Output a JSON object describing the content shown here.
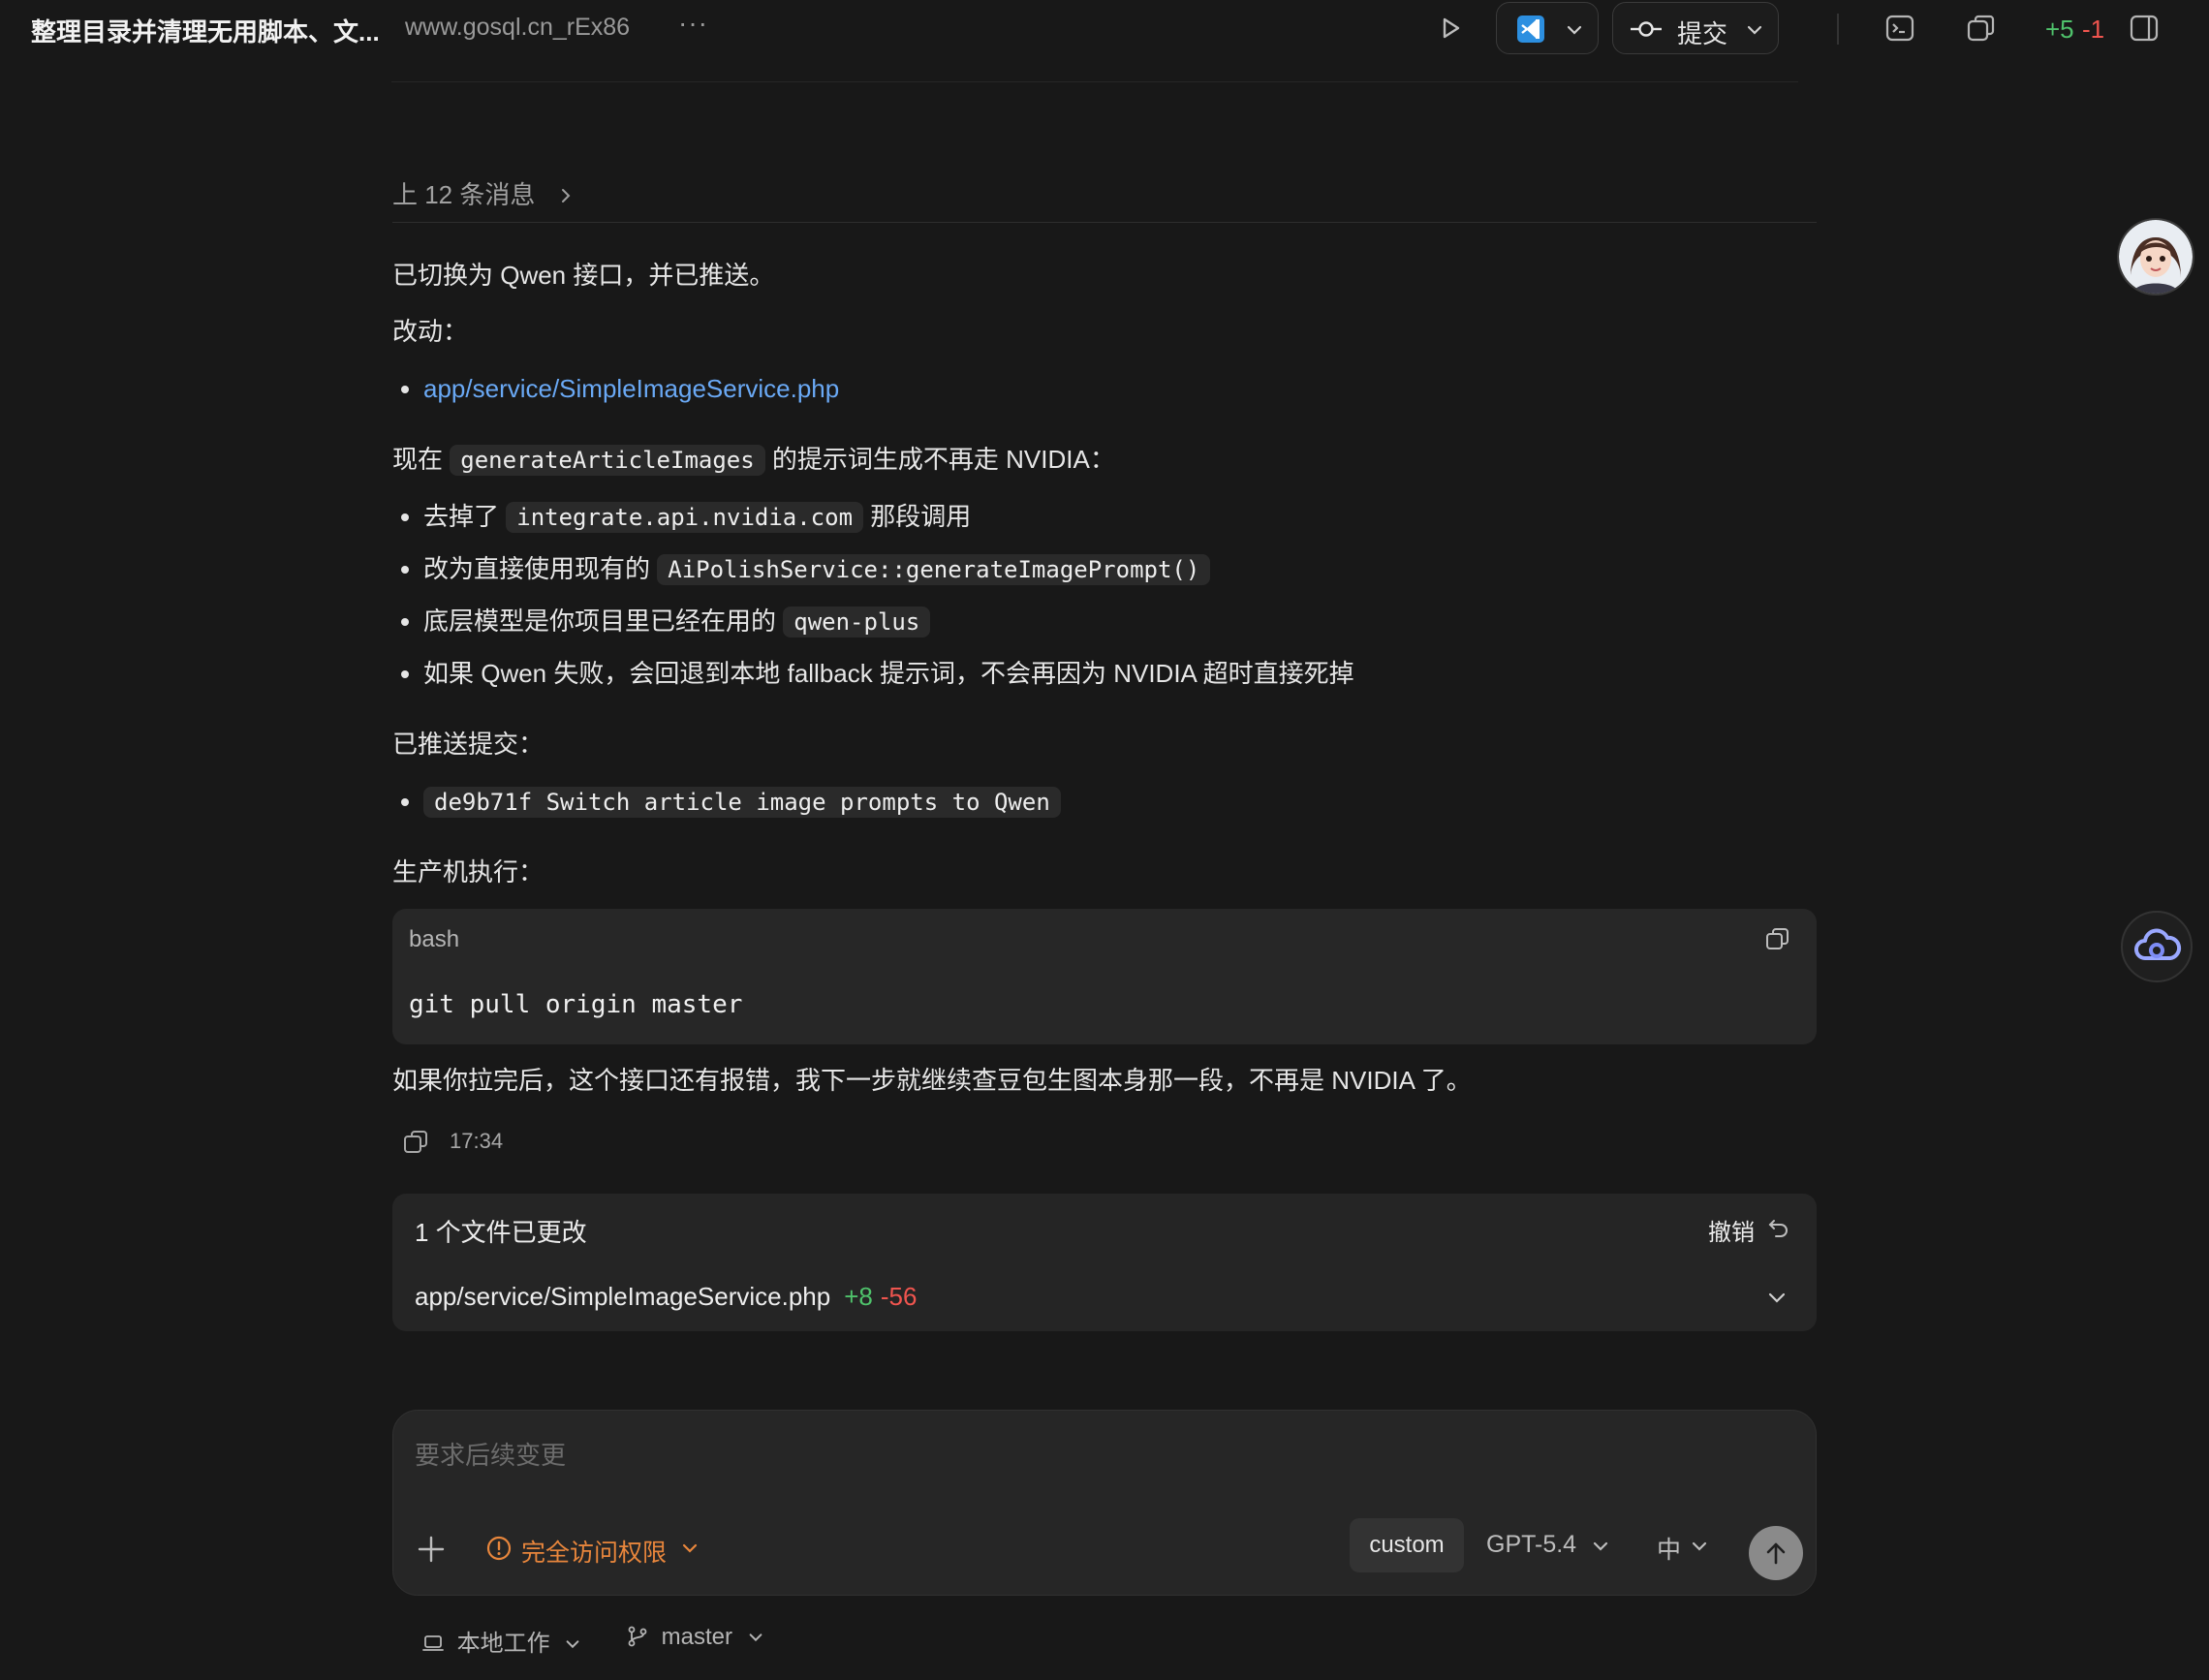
{
  "header": {
    "title": "整理目录并清理无用脚本、文...",
    "subtitle": "www.gosql.cn_rEx86",
    "more_icon": "ellipsis-icon",
    "editor_icon": "vscode-icon",
    "commit_label": "提交",
    "diff_added": "+5",
    "diff_removed": "-1"
  },
  "conversation": {
    "previous_messages": "上 12 条消息",
    "para1": "已切换为 Qwen 接口，并已推送。",
    "changes_heading": "改动：",
    "changed_file_link": "app/service/SimpleImageService.php",
    "para2": {
      "pre": "现在",
      "code": "generateArticleImages",
      "post": "的提示词生成不再走 NVIDIA："
    },
    "bullets": [
      {
        "pre": "去掉了",
        "code": "integrate.api.nvidia.com",
        "post": "那段调用"
      },
      {
        "pre": "改为直接使用现有的",
        "code": "AiPolishService::generateImagePrompt()",
        "post": ""
      },
      {
        "pre": "底层模型是你项目里已经在用的",
        "code": "qwen-plus",
        "post": ""
      },
      {
        "text": "如果 Qwen 失败，会回退到本地 fallback 提示词，不会再因为 NVIDIA 超时直接死掉"
      }
    ],
    "pushed_heading": "已推送提交：",
    "commit_code": "de9b71f Switch article image prompts to Qwen",
    "exec_heading": "生产机执行：",
    "code_block": {
      "lang": "bash",
      "command": "git pull origin master"
    },
    "closing": "如果你拉完后，这个接口还有报错，我下一步就继续查豆包生图本身那一段，不再是 NVIDIA 了。",
    "timestamp": "17:34"
  },
  "changes_card": {
    "header": "1 个文件已更改",
    "undo_label": "撤销",
    "file": "app/service/SimpleImageService.php",
    "added": "+8",
    "removed": "-56"
  },
  "composer": {
    "placeholder": "要求后续变更",
    "permission_label": "完全访问权限",
    "custom_label": "custom",
    "model_label": "GPT-5.4",
    "effort_label": "中"
  },
  "footer": {
    "workspace_label": "本地工作",
    "branch_label": "master"
  },
  "colors": {
    "background": "#181818",
    "link": "#6aa9f5",
    "added": "#4fc26b",
    "removed": "#f0554f",
    "warning": "#e8863c"
  }
}
